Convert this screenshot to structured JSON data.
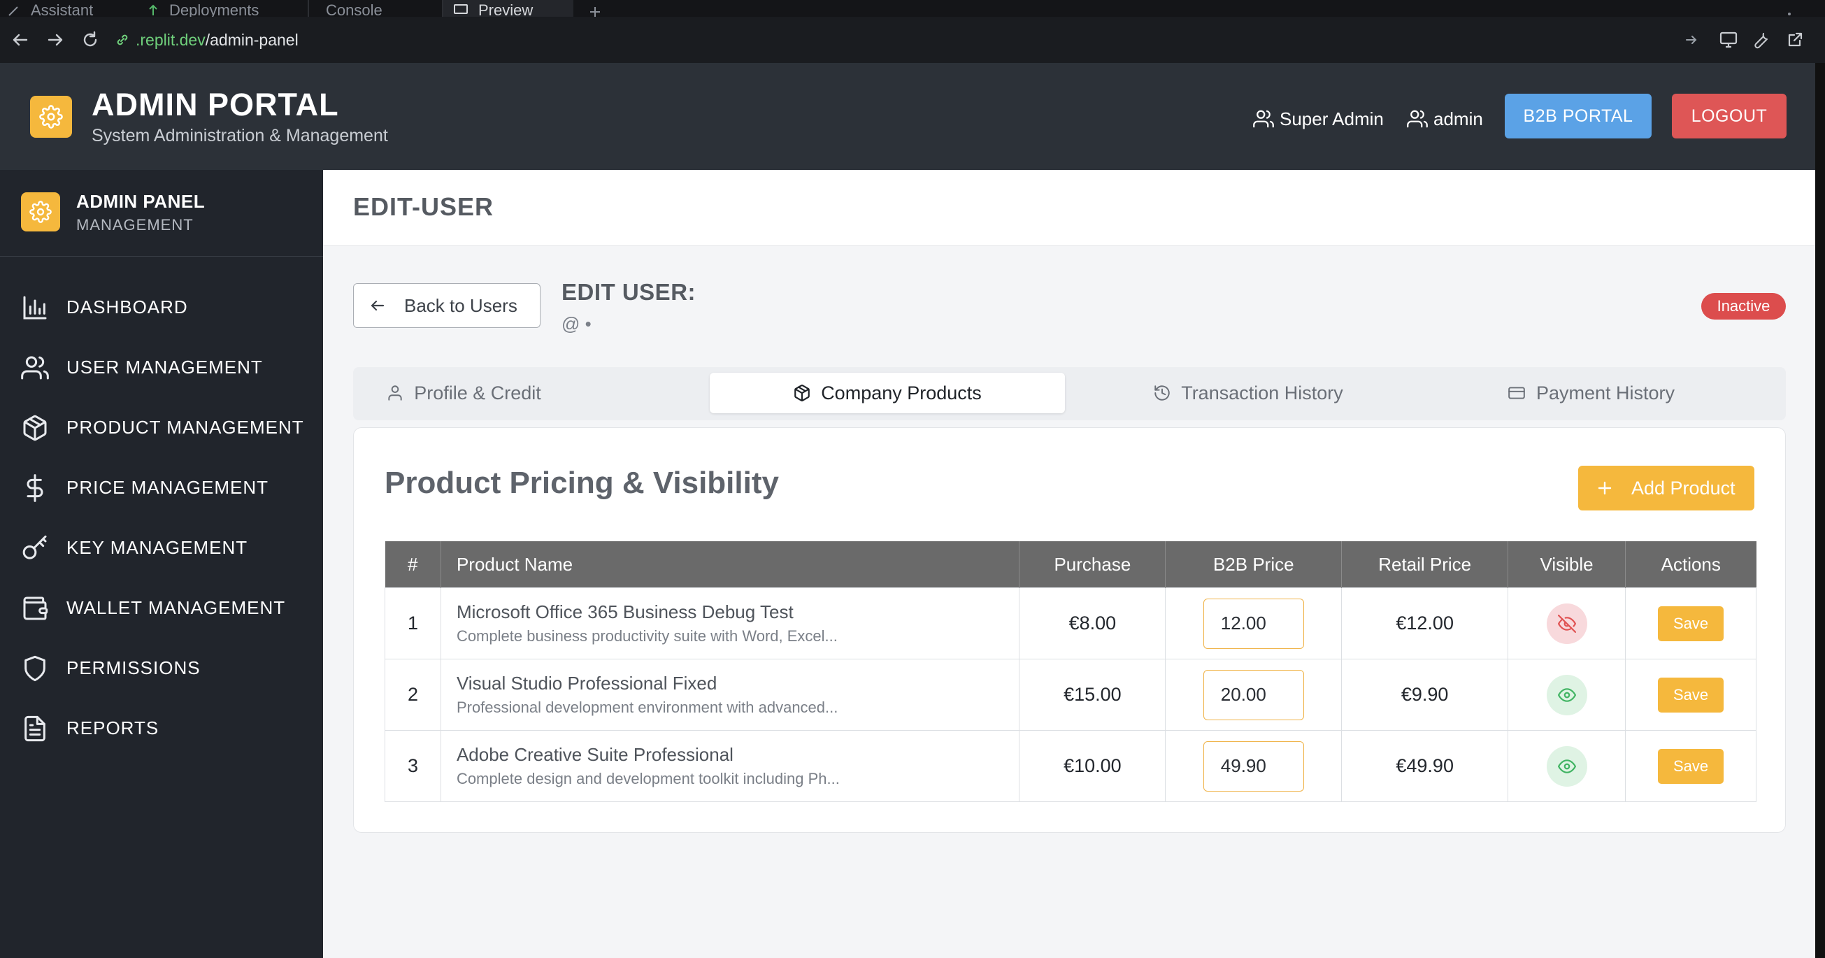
{
  "browser": {
    "tabs": [
      {
        "label": "Assistant"
      },
      {
        "label": "Deployments"
      },
      {
        "label": "Console"
      },
      {
        "label": "Preview"
      }
    ],
    "url_host": ".replit.dev",
    "url_path": "/admin-panel"
  },
  "header": {
    "title": "ADMIN PORTAL",
    "subtitle": "System Administration & Management",
    "role": "Super Admin",
    "username": "admin",
    "b2b_button": "B2B PORTAL",
    "logout_button": "LOGOUT"
  },
  "sidebar": {
    "title": "ADMIN PANEL",
    "subtitle": "MANAGEMENT",
    "items": [
      {
        "label": "DASHBOARD",
        "icon": "bar-chart-icon"
      },
      {
        "label": "USER MANAGEMENT",
        "icon": "users-icon"
      },
      {
        "label": "PRODUCT MANAGEMENT",
        "icon": "package-icon"
      },
      {
        "label": "PRICE MANAGEMENT",
        "icon": "dollar-icon"
      },
      {
        "label": "KEY MANAGEMENT",
        "icon": "key-icon"
      },
      {
        "label": "WALLET MANAGEMENT",
        "icon": "wallet-icon"
      },
      {
        "label": "PERMISSIONS",
        "icon": "shield-icon"
      },
      {
        "label": "REPORTS",
        "icon": "document-icon"
      }
    ]
  },
  "page": {
    "title": "EDIT-USER",
    "back_button": "Back to Users",
    "edit_title": "EDIT USER:",
    "edit_subtitle": "@ •",
    "status": "Inactive"
  },
  "tabs": [
    {
      "label": "Profile & Credit",
      "icon": "user-icon",
      "active": false
    },
    {
      "label": "Company Products",
      "icon": "package-icon",
      "active": true
    },
    {
      "label": "Transaction History",
      "icon": "history-icon",
      "active": false
    },
    {
      "label": "Payment History",
      "icon": "credit-card-icon",
      "active": false
    }
  ],
  "products": {
    "title": "Product Pricing & Visibility",
    "add_button": "Add Product",
    "columns": [
      "#",
      "Product Name",
      "Purchase",
      "B2B Price",
      "Retail Price",
      "Visible",
      "Actions"
    ],
    "rows": [
      {
        "index": "1",
        "name": "Microsoft Office 365 Business Debug Test",
        "description": "Complete business productivity suite with Word, Excel...",
        "purchase": "€8.00",
        "b2b": "12.00",
        "retail": "€12.00",
        "visible": false,
        "action": "Save"
      },
      {
        "index": "2",
        "name": "Visual Studio Professional Fixed",
        "description": "Professional development environment with advanced...",
        "purchase": "€15.00",
        "b2b": "20.00",
        "retail": "€9.90",
        "visible": true,
        "action": "Save"
      },
      {
        "index": "3",
        "name": "Adobe Creative Suite Professional",
        "description": "Complete design and development toolkit including Ph...",
        "purchase": "€10.00",
        "b2b": "49.90",
        "retail": "€49.90",
        "visible": true,
        "action": "Save"
      }
    ]
  },
  "colors": {
    "accent": "#f5b83d",
    "header_bg": "#2c3138",
    "sidebar_bg": "#21252c",
    "b2b_button": "#5ba2e6",
    "logout_button": "#de5656",
    "inactive_badge": "#dc4d4d"
  }
}
